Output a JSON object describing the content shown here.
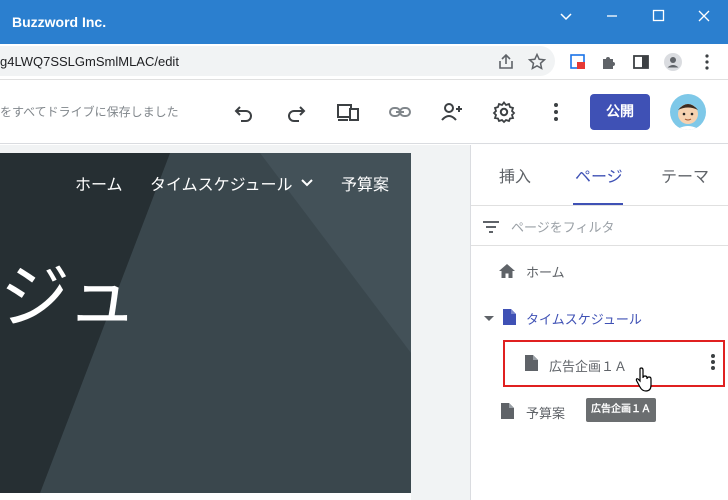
{
  "window": {
    "title": "Buzzword Inc."
  },
  "browser": {
    "url": "g4LWQ7SSLGmSmlMLAC/edit"
  },
  "toolbar": {
    "saved_text": "をすべてドライブに保存しました",
    "publish_label": "公開"
  },
  "site": {
    "nav": [
      "ホーム",
      "タイムスケジュール",
      "予算案"
    ],
    "hero_text": "ジュ"
  },
  "panel": {
    "tabs": [
      "挿入",
      "ページ",
      "テーマ"
    ],
    "filter_placeholder": "ページをフィルタ",
    "pages": {
      "home": "ホーム",
      "schedule": "タイムスケジュール",
      "ad_plan": "広告企画１Ａ",
      "budget": "予算案"
    },
    "tooltip": "広告企画１Ａ"
  },
  "colors": {
    "accent": "#3f51b5",
    "titlebar": "#2b7fcf",
    "selection": "#e02020"
  }
}
